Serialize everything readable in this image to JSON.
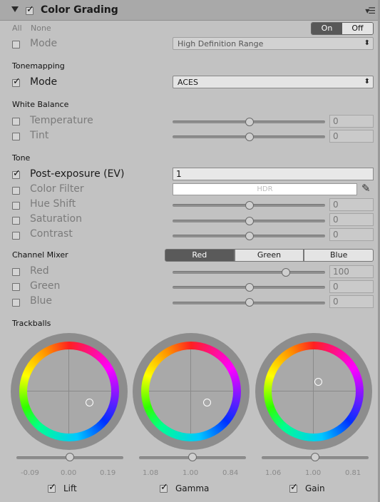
{
  "header": {
    "title": "Color Grading",
    "enabled": true
  },
  "top": {
    "all_label": "All",
    "none_label": "None",
    "toggle_on": "On",
    "toggle_off": "Off"
  },
  "mode": {
    "label": "Mode",
    "value": "High Definition Range"
  },
  "tonemapping": {
    "section": "Tonemapping",
    "mode_label": "Mode",
    "mode_value": "ACES"
  },
  "white_balance": {
    "section": "White Balance",
    "temperature": {
      "label": "Temperature",
      "value": "0",
      "fraction": 0.5
    },
    "tint": {
      "label": "Tint",
      "value": "0",
      "fraction": 0.5
    }
  },
  "tone": {
    "section": "Tone",
    "post_exposure": {
      "label": "Post-exposure (EV)",
      "value": "1"
    },
    "color_filter": {
      "label": "Color Filter",
      "hdr": "HDR"
    },
    "hue_shift": {
      "label": "Hue Shift",
      "value": "0",
      "fraction": 0.5
    },
    "saturation": {
      "label": "Saturation",
      "value": "0",
      "fraction": 0.5
    },
    "contrast": {
      "label": "Contrast",
      "value": "0",
      "fraction": 0.5
    }
  },
  "channel_mixer": {
    "section": "Channel Mixer",
    "tabs": [
      "Red",
      "Green",
      "Blue"
    ],
    "selected": "Red",
    "red": {
      "label": "Red",
      "value": "100",
      "fraction": 0.74
    },
    "green": {
      "label": "Green",
      "value": "0",
      "fraction": 0.5
    },
    "blue": {
      "label": "Blue",
      "value": "0",
      "fraction": 0.5
    }
  },
  "trackballs": {
    "section": "Trackballs",
    "lift": {
      "label": "Lift",
      "values": [
        "-0.09",
        "0.00",
        "0.19"
      ],
      "checked": true
    },
    "gamma": {
      "label": "Gamma",
      "values": [
        "1.08",
        "1.00",
        "0.84"
      ],
      "checked": true
    },
    "gain": {
      "label": "Gain",
      "values": [
        "1.06",
        "1.00",
        "0.81"
      ],
      "checked": true
    }
  }
}
